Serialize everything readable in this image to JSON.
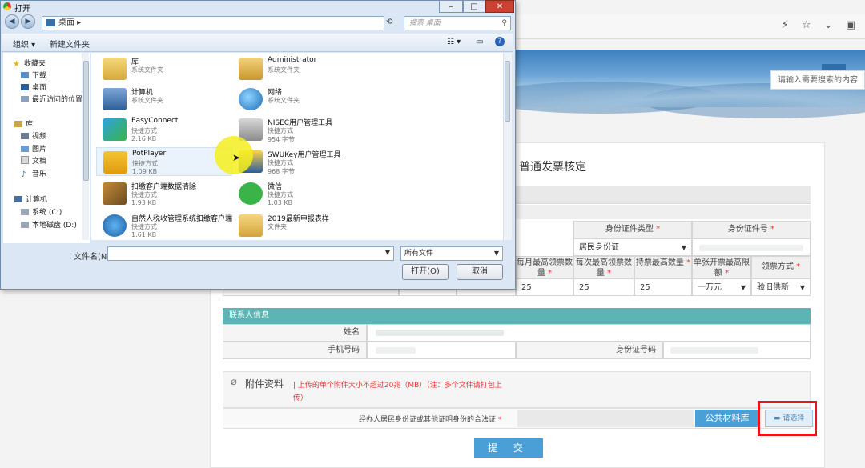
{
  "browser": {
    "toolbar_icons": "⚡ ☆ ⌄ ▣"
  },
  "site": {
    "search_placeholder": "请输入需要搜索的内容",
    "page_title": "普通发票核定"
  },
  "form": {
    "headers": {
      "id_type": "身份证件类型",
      "id_number": "身份证件号",
      "monthly_max": "每月最高领票数量",
      "per_max": "每次最高领票数量",
      "hold_max": "持票最高数量",
      "single_max": "单张开票最高限额",
      "method": "领票方式",
      "required": "*"
    },
    "row": {
      "id_type_value": "居民身份证",
      "monthly": "25",
      "per": "25",
      "hold": "25",
      "limit": "一万元",
      "method": "验旧供新"
    },
    "contact": {
      "section": "联系人信息",
      "name_label": "姓名",
      "phone_label": "手机号码",
      "idno_label": "身份证号码"
    },
    "attachment": {
      "title": "附件资料",
      "note": "| 上传的单个附件大小不超过20兆（MB）（注：多个文件请打包上传）",
      "field_label": "经办人居民身份证或其他证明身份的合法证",
      "public_lib": "公共材料库",
      "choose": "请选择"
    },
    "submit": "提 交"
  },
  "dialog": {
    "title": "打开",
    "address": "桌面",
    "search_placeholder": "搜索 桌面",
    "toolbar": {
      "organize": "组织 ▾",
      "new_folder": "新建文件夹"
    },
    "nav": [
      {
        "label": "收藏夹",
        "icon": "star-icon"
      },
      {
        "label": "下载",
        "icon": "download-folder-icon"
      },
      {
        "label": "桌面",
        "icon": "desktop-icon"
      },
      {
        "label": "最近访问的位置",
        "icon": "recent-places-icon"
      },
      {
        "label": "库",
        "icon": "library-icon"
      },
      {
        "label": "视频",
        "icon": "video-icon"
      },
      {
        "label": "图片",
        "icon": "picture-icon"
      },
      {
        "label": "文档",
        "icon": "document-icon"
      },
      {
        "label": "音乐",
        "icon": "music-icon"
      },
      {
        "label": "计算机",
        "icon": "computer-icon"
      },
      {
        "label": "系统 (C:)",
        "icon": "drive-icon"
      },
      {
        "label": "本地磁盘 (D:)",
        "icon": "drive-icon"
      }
    ],
    "files": [
      {
        "name": "库",
        "type": "系统文件夹",
        "size": ""
      },
      {
        "name": "Administrator",
        "type": "系统文件夹",
        "size": ""
      },
      {
        "name": "计算机",
        "type": "系统文件夹",
        "size": ""
      },
      {
        "name": "网络",
        "type": "系统文件夹",
        "size": ""
      },
      {
        "name": "EasyConnect",
        "type": "快捷方式",
        "size": "2.16 KB"
      },
      {
        "name": "NISEC用户管理工具",
        "type": "快捷方式",
        "size": "954 字节"
      },
      {
        "name": "PotPlayer",
        "type": "快捷方式",
        "size": "1.09 KB"
      },
      {
        "name": "SWUKey用户管理工具",
        "type": "快捷方式",
        "size": "968 字节"
      },
      {
        "name": "扣缴客户端数据清除",
        "type": "快捷方式",
        "size": "1.93 KB"
      },
      {
        "name": "微信",
        "type": "快捷方式",
        "size": "1.03 KB"
      },
      {
        "name": "自然人税收管理系统扣缴客户端",
        "type": "快捷方式",
        "size": "1.61 KB"
      },
      {
        "name": "2019最新申报表样",
        "type": "文件夹",
        "size": ""
      }
    ],
    "filename_label": "文件名(N):",
    "filetype": "所有文件",
    "open_btn": "打开(O)",
    "cancel_btn": "取消"
  }
}
